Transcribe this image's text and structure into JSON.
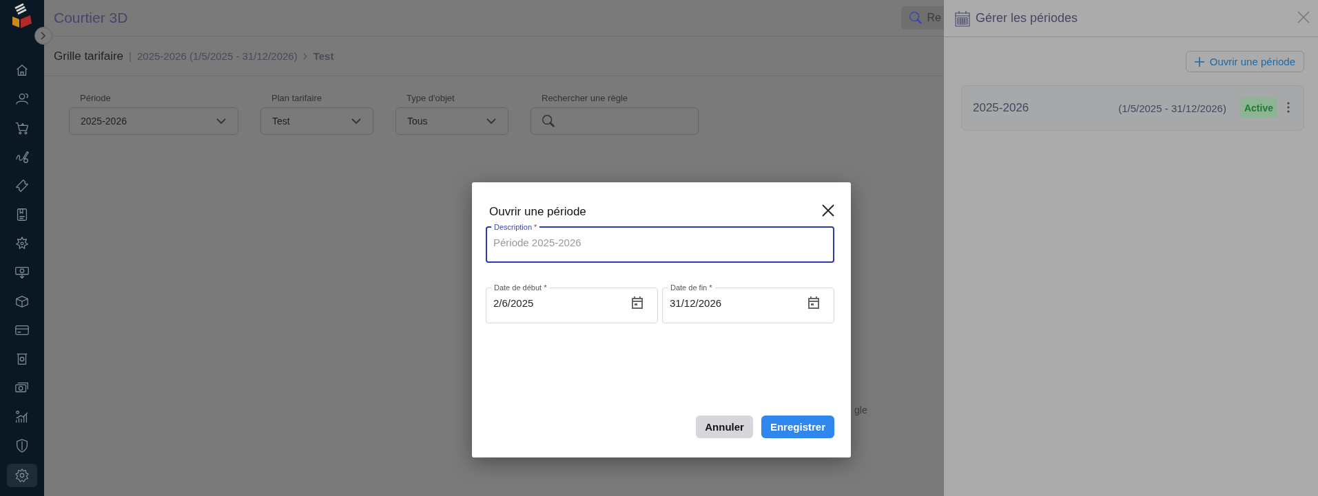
{
  "sidebar": {
    "items": [
      {
        "selected": false
      },
      {
        "selected": false
      },
      {
        "selected": false
      },
      {
        "selected": false
      },
      {
        "selected": false
      },
      {
        "selected": false
      },
      {
        "selected": false
      },
      {
        "selected": false
      },
      {
        "selected": false
      },
      {
        "selected": false
      },
      {
        "selected": false
      },
      {
        "selected": false
      },
      {
        "selected": false
      },
      {
        "selected": false
      },
      {
        "selected": true
      }
    ]
  },
  "header": {
    "title": "Courtier 3D",
    "search_button": "Re"
  },
  "breadcrumb": {
    "title": "Grille tarifaire",
    "separator": "|",
    "path": "2025-2026 (1/5/2025 - 31/12/2026)",
    "current": "Test"
  },
  "filters": [
    {
      "kind": "select",
      "label": "Période",
      "value": "2025-2026"
    },
    {
      "kind": "select",
      "label": "Plan tarifaire",
      "value": "Test"
    },
    {
      "kind": "select",
      "label": "Type d'objet",
      "value": "Tous"
    },
    {
      "kind": "search",
      "label": "Rechercher une règle"
    }
  ],
  "empty_state": "gle",
  "panel": {
    "title": "Gérer les périodes",
    "add_button": "Ouvrir une période",
    "periods": [
      {
        "name": "2025-2026",
        "range": "(1/5/2025 - 31/12/2026)",
        "status": "Active"
      }
    ]
  },
  "dialog": {
    "title": "Ouvrir une période",
    "fields": [
      {
        "kind": "text",
        "label": "Description",
        "required_mark": "*",
        "placeholder": "Période 2025-2026",
        "focused": true
      },
      {
        "kind": "date",
        "label": "Date de début *",
        "value": "2/6/2025",
        "focused": false
      },
      {
        "kind": "date",
        "label": "Date de fin *",
        "value": "31/12/2026",
        "focused": false
      }
    ],
    "buttons": [
      {
        "kind": "secondary",
        "label": "Annuler"
      },
      {
        "kind": "primary",
        "label": "Enregistrer"
      }
    ]
  }
}
